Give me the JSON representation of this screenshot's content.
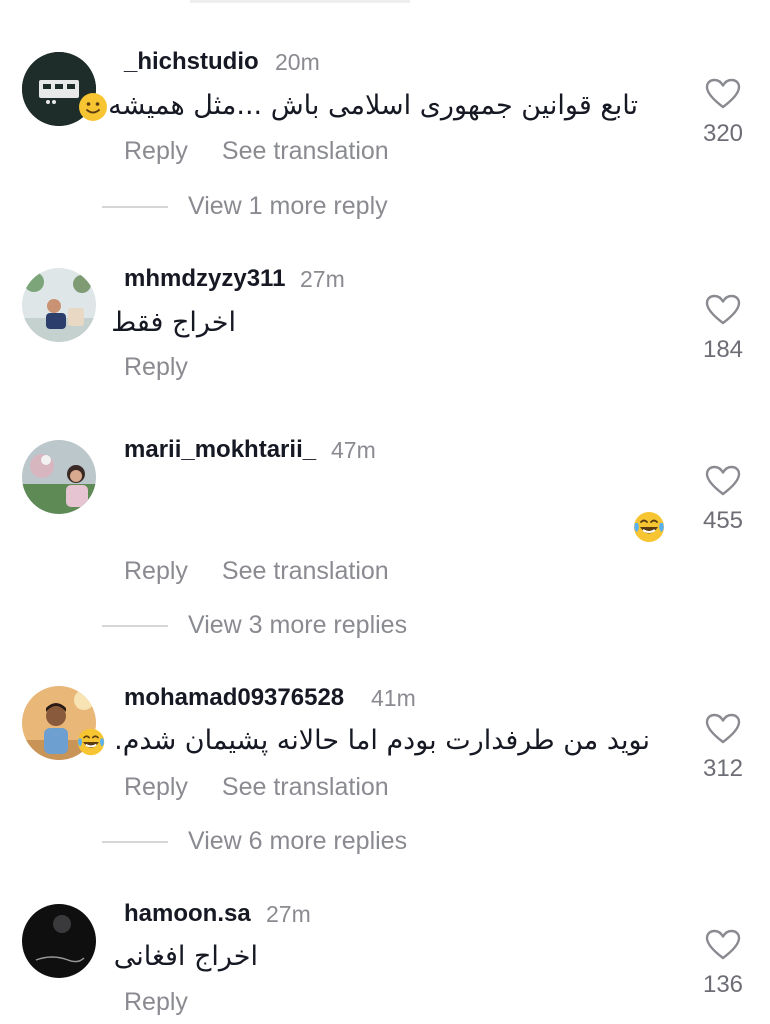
{
  "comments": [
    {
      "username": "_hichstudio",
      "time": "20m",
      "text": "تابع قوانین جمهوری اسلامی باش ...مثل همیشه",
      "emoji": "slightly-smiling-face",
      "reply": "Reply",
      "translate": "See translation",
      "likes": "320",
      "more": "View 1 more reply"
    },
    {
      "username": "mhmdzyzy311",
      "time": "27m",
      "text": "اخراج فقط",
      "reply": "Reply",
      "likes": "184"
    },
    {
      "username": "marii_mokhtarii_",
      "time": "47m",
      "emoji": "tears-of-joy-face",
      "reply": "Reply",
      "translate": "See translation",
      "likes": "455",
      "more": "View 3 more replies"
    },
    {
      "username": "mohamad09376528",
      "time": "41m",
      "text": "نوید من طرفدارت بودم اما حالانه پشیمان شدم.",
      "emoji": "tears-of-joy-face",
      "reply": "Reply",
      "translate": "See translation",
      "likes": "312",
      "more": "View 6 more replies"
    },
    {
      "username": "hamoon.sa",
      "time": "27m",
      "text": "اخراج افغانی",
      "reply": "Reply",
      "likes": "136"
    }
  ],
  "colors": {
    "username": "#161823",
    "secondary": "#8a8b91",
    "like_icon": "#8a8b91",
    "emoji_yellow": "#f7c531"
  }
}
